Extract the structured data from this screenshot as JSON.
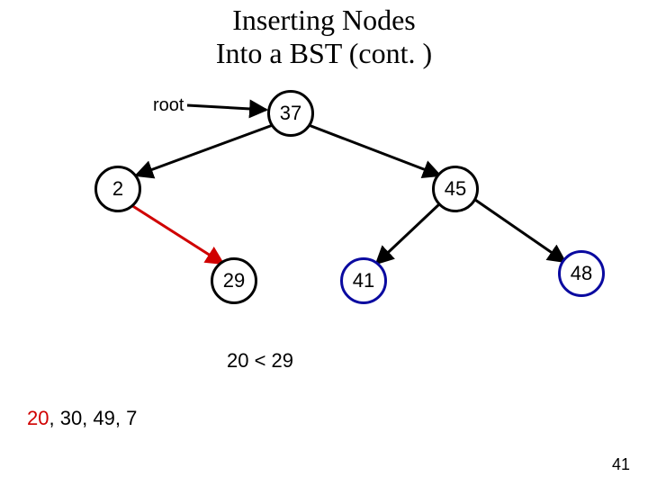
{
  "title_line1": "Inserting Nodes",
  "title_line2": "Into a BST (cont. )",
  "root_label": "root",
  "nodes": {
    "n37": "37",
    "n2": "2",
    "n45": "45",
    "n29": "29",
    "n41": "41",
    "n48": "48"
  },
  "comparison": "20 < 29",
  "queue": {
    "first": "20",
    "rest": ", 30, 49, 7"
  },
  "slide_number": "41"
}
